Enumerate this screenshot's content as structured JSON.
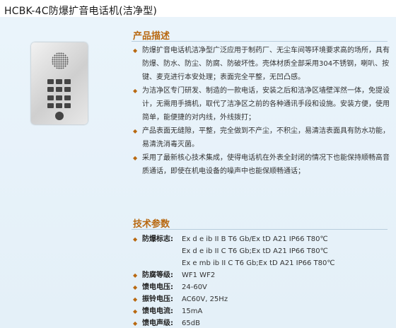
{
  "page_title": "HCBK-4C防爆扩音电话机(洁净型)",
  "desc_heading": "产品描述",
  "desc_items": [
    "防爆扩音电话机洁净型广泛应用于制药厂、无尘车间等环境要求高的场所，具有防爆、防水、防尘、防腐、防破坏性。壳体材质全部采用304不锈钢，喇叭、按键、麦克进行本安处理；表面完全平整，无凹凸感。",
    "为洁净区专门研发、制造的一款电话，安装之后和洁净区墙壁浑然一体，免提设计，无需用手摘机，取代了洁净区之前的各种通讯手段和设施。安装方便，使用简单，能便捷的对内线，外线拨打；",
    "产品表面无缝隙，平整，完全做到不产尘，不积尘，易清洁表面具有防水功能，易清洗消毒灭菌。",
    "采用了最新核心技术集成，使得电话机在外表全封闭的情况下也能保持顺畅高音质通话，即使在机电设备的噪声中也能保顺畅通话；"
  ],
  "specs_heading": "技术参数",
  "specs": {
    "explosion_label": "防爆标志:",
    "explosion_lines": [
      "Ex d e ib II B T6 Gb/Ex tD A21 IP66 T80℃",
      "Ex d e ib II C T6 Gb;Ex tD A21 IP66 T80℃",
      "Ex e mb ib II C T6 Gb;Ex tD A21 IP66 T80℃"
    ],
    "rows": [
      {
        "label": "防腐等级:",
        "value": "WF1  WF2"
      },
      {
        "label": "馈电电压:",
        "value": "24-60V"
      },
      {
        "label": "振铃电压:",
        "value": "AC60V, 25Hz"
      },
      {
        "label": "馈电电流:",
        "value": "15mA"
      },
      {
        "label": "馈电声级:",
        "value": "65dB"
      }
    ]
  },
  "colors": {
    "accent": "#b86810",
    "panel": "#e7f2f9"
  }
}
